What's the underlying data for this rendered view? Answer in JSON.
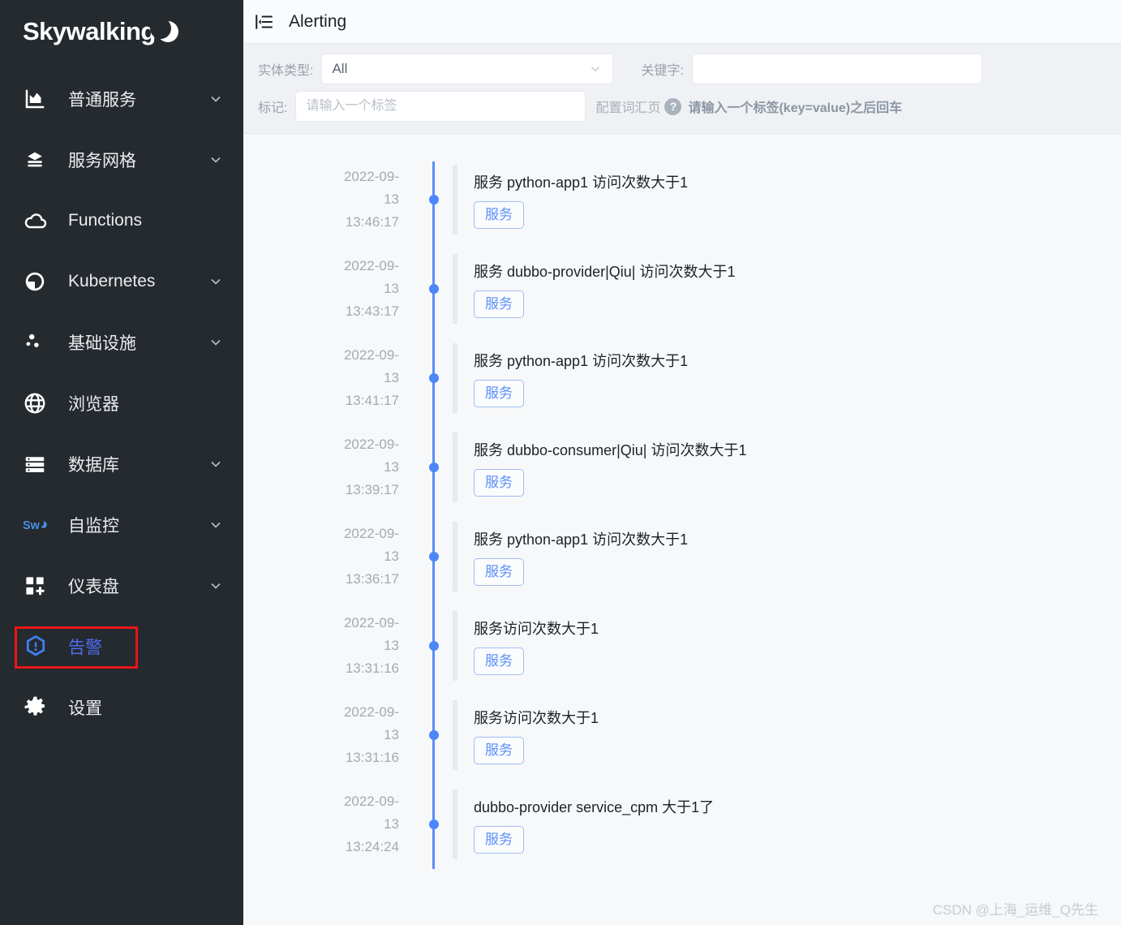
{
  "brand": {
    "name": "Skywalking"
  },
  "sidebar": {
    "items": [
      {
        "label": "普通服务",
        "icon": "chart-icon",
        "expandable": true,
        "active": false
      },
      {
        "label": "服务网格",
        "icon": "mesh-icon",
        "expandable": true,
        "active": false
      },
      {
        "label": "Functions",
        "icon": "cloud-icon",
        "expandable": false,
        "active": false
      },
      {
        "label": "Kubernetes",
        "icon": "pie-icon",
        "expandable": true,
        "active": false
      },
      {
        "label": "基础设施",
        "icon": "nodes-icon",
        "expandable": true,
        "active": false
      },
      {
        "label": "浏览器",
        "icon": "globe-icon",
        "expandable": false,
        "active": false
      },
      {
        "label": "数据库",
        "icon": "database-icon",
        "expandable": true,
        "active": false
      },
      {
        "label": "自监控",
        "icon": "sw-logo-icon",
        "expandable": true,
        "active": false
      },
      {
        "label": "仪表盘",
        "icon": "dashboard-icon",
        "expandable": true,
        "active": false
      },
      {
        "label": "告警",
        "icon": "alarm-shield-icon",
        "expandable": false,
        "active": true
      },
      {
        "label": "设置",
        "icon": "gear-icon",
        "expandable": false,
        "active": false
      }
    ]
  },
  "topbar": {
    "title": "Alerting",
    "collapse_icon": "collapse-menu-icon"
  },
  "filters": {
    "entity_type_label": "实体类型:",
    "entity_type_value": "All",
    "keyword_label": "关键字:",
    "keyword_value": "",
    "keyword_placeholder": "",
    "tag_label": "标记:",
    "tag_value": "",
    "tag_placeholder": "请输入一个标签",
    "config_link": "配置词汇页",
    "help_glyph": "?",
    "hint": "请输入一个标签(key=value)之后回车"
  },
  "alerts": [
    {
      "date": "2022-09-13",
      "time": "13:46:17",
      "message": "服务 python-app1 访问次数大于1",
      "tag": "服务"
    },
    {
      "date": "2022-09-13",
      "time": "13:43:17",
      "message": "服务 dubbo-provider|Qiu| 访问次数大于1",
      "tag": "服务"
    },
    {
      "date": "2022-09-13",
      "time": "13:41:17",
      "message": "服务 python-app1 访问次数大于1",
      "tag": "服务"
    },
    {
      "date": "2022-09-13",
      "time": "13:39:17",
      "message": "服务 dubbo-consumer|Qiu| 访问次数大于1",
      "tag": "服务"
    },
    {
      "date": "2022-09-13",
      "time": "13:36:17",
      "message": "服务 python-app1 访问次数大于1",
      "tag": "服务"
    },
    {
      "date": "2022-09-13",
      "time": "13:31:16",
      "message": "服务访问次数大于1",
      "tag": "服务"
    },
    {
      "date": "2022-09-13",
      "time": "13:31:16",
      "message": "服务访问次数大于1",
      "tag": "服务"
    },
    {
      "date": "2022-09-13",
      "time": "13:24:24",
      "message": "dubbo-provider service_cpm 大于1了",
      "tag": "服务"
    }
  ],
  "watermark": "CSDN @上海_运维_Q先生",
  "colors": {
    "sidebar_bg": "#252a2f",
    "accent_blue": "#4d86f7",
    "active_item": "#4e6ef2",
    "highlight_box": "#e81717",
    "timeline_line": "#5b8ff9",
    "tag_border": "#9fbdf5",
    "content_bg": "#f7f8fa",
    "filterbar_bg": "#eff1f4"
  }
}
